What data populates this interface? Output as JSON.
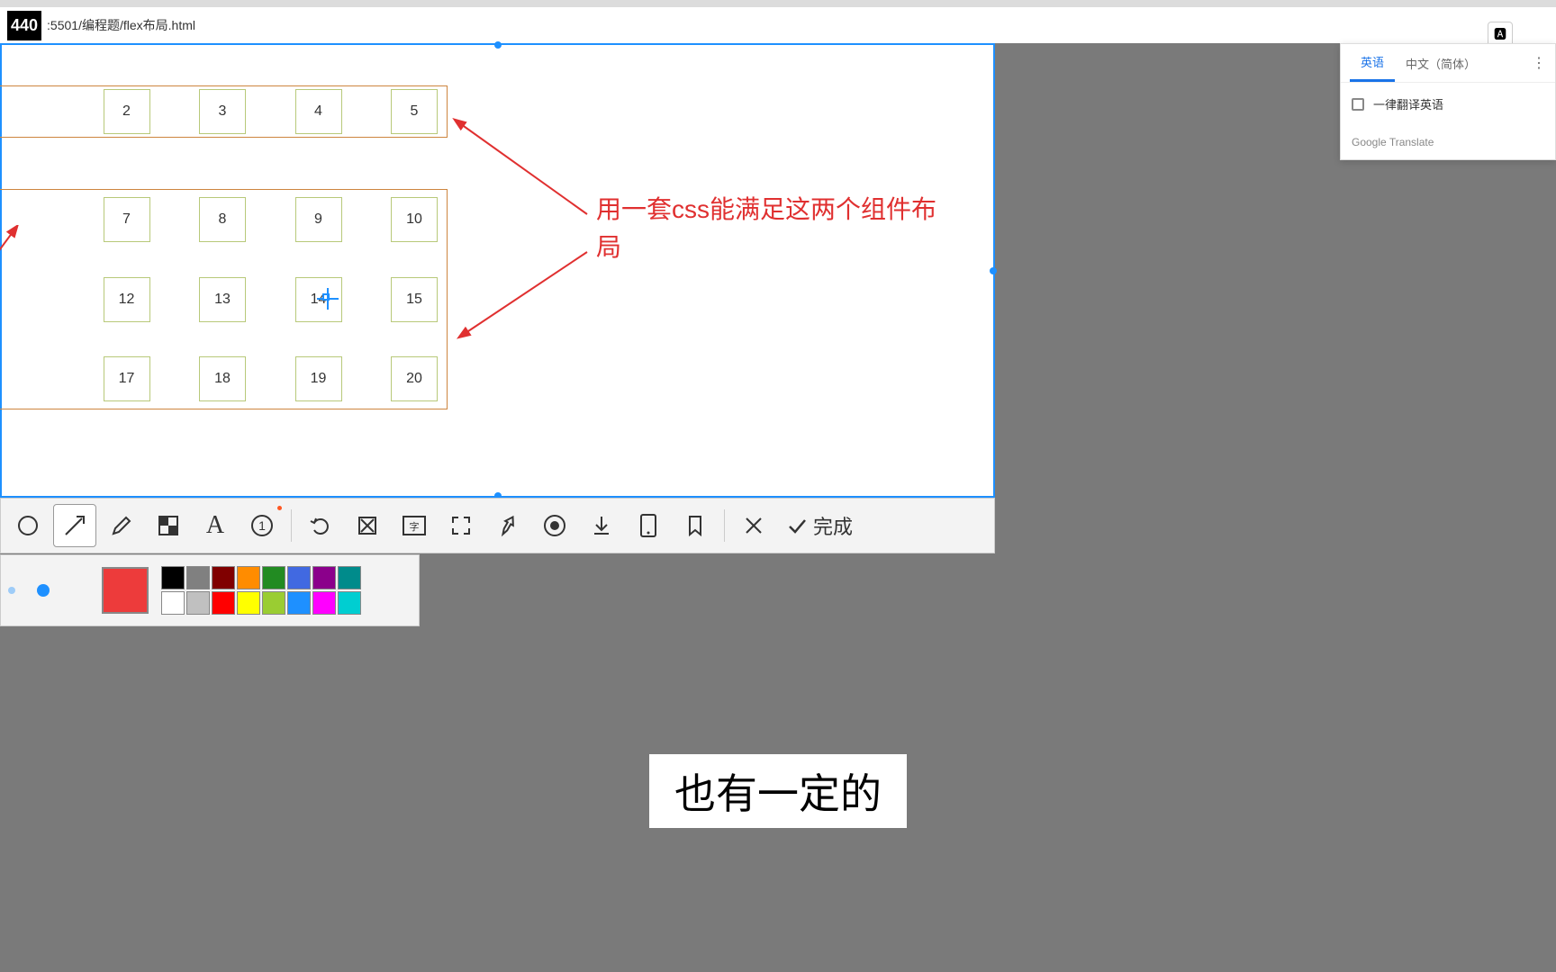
{
  "address_bar": {
    "badge": "440",
    "url": ":5501/编程题/flex布局.html"
  },
  "translate_panel": {
    "tab_en": "英语",
    "tab_zh": "中文（简体）",
    "checkbox_label": "一律翻译英语",
    "footer": "Google Translate",
    "icon_label": "译"
  },
  "flex_demo": {
    "row1": [
      "",
      "2",
      "3",
      "4",
      "5"
    ],
    "grid": [
      [
        "",
        "7",
        "8",
        "9",
        "10"
      ],
      [
        "",
        "12",
        "13",
        "14",
        "15"
      ],
      [
        "",
        "17",
        "18",
        "19",
        "20"
      ]
    ],
    "annotation": "用一套css能满足这两个组件布局"
  },
  "toolbar": {
    "complete_label": "完成",
    "tools": {
      "circle": "circle",
      "arrow": "arrow",
      "pencil": "pencil",
      "mosaic": "mosaic",
      "text": "text",
      "number": "number",
      "undo": "undo",
      "cut": "cut",
      "ocr": "ocr",
      "expand": "expand",
      "pin": "pin",
      "record": "record",
      "download": "download",
      "phone": "phone",
      "bookmark": "bookmark",
      "close": "close"
    }
  },
  "colors": {
    "current": "#ed3b3b",
    "grid": [
      "#000000",
      "#808080",
      "#800000",
      "#ff8c00",
      "#228b22",
      "#4169e1",
      "#8b008b",
      "#008b8b",
      "#ffffff",
      "#c0c0c0",
      "#ff0000",
      "#ffff00",
      "#9acd32",
      "#1e90ff",
      "#ff00ff",
      "#00ced1"
    ]
  },
  "subtitle": "也有一定的"
}
